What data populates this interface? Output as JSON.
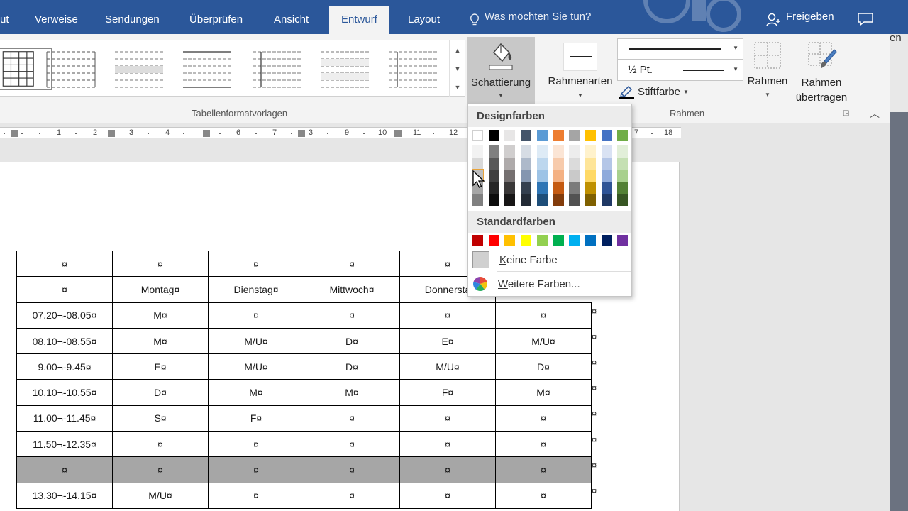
{
  "tabs": [
    "ut",
    "Verweise",
    "Sendungen",
    "Überprüfen",
    "Ansicht",
    "Entwurf",
    "Layout"
  ],
  "active_tab": "Entwurf",
  "tell_me": "Was möchten Sie tun?",
  "share": "Freigeben",
  "strip_letters": "en",
  "ribbon": {
    "table_styles_label": "Tabellenformatvorlagen",
    "shading": "Schattierung",
    "border_styles": "Rahmenarten",
    "pen_weight": "½ Pt.",
    "pen_color": "Stiftfarbe",
    "borders": "Rahmen",
    "border_painter_line1": "Rahmen",
    "border_painter_line2": "übertragen",
    "borders_group_label": "Rahmen"
  },
  "ruler_numbers": [
    "1",
    "2",
    "3",
    "4",
    "6",
    "7",
    "3",
    "9",
    "10",
    "11",
    "12",
    "7",
    "18"
  ],
  "dropdown": {
    "theme_colors_label": "Designfarben",
    "standard_colors_label": "Standardfarben",
    "no_color": "Keine Farbe",
    "more_colors": "Weitere Farben...",
    "theme_top": [
      "#ffffff",
      "#000000",
      "#e7e6e6",
      "#44546a",
      "#5b9bd5",
      "#ed7d31",
      "#a5a5a5",
      "#ffc000",
      "#4472c4",
      "#70ad47"
    ],
    "theme_shades": [
      [
        "#f2f2f2",
        "#d9d9d9",
        "#bfbfbf",
        "#a6a6a6",
        "#808080"
      ],
      [
        "#808080",
        "#595959",
        "#404040",
        "#262626",
        "#0d0d0d"
      ],
      [
        "#d0cece",
        "#aeaaaa",
        "#757070",
        "#3a3838",
        "#171616"
      ],
      [
        "#d6dce4",
        "#adb9ca",
        "#8496b0",
        "#333f4f",
        "#222a35"
      ],
      [
        "#deebf6",
        "#bdd7ee",
        "#9dc3e6",
        "#2e75b5",
        "#1e4e79"
      ],
      [
        "#fbe5d5",
        "#f7cbac",
        "#f4b183",
        "#c55a11",
        "#833c0b"
      ],
      [
        "#ededed",
        "#dbdbdb",
        "#c9c9c9",
        "#7b7b7b",
        "#525252"
      ],
      [
        "#fff2cc",
        "#fee599",
        "#ffd965",
        "#bf9000",
        "#7f6000"
      ],
      [
        "#d9e2f3",
        "#b4c6e7",
        "#8eaadb",
        "#2f5496",
        "#1f3864"
      ],
      [
        "#e2efd9",
        "#c5e0b3",
        "#a8d08d",
        "#538135",
        "#375623"
      ]
    ],
    "standard": [
      "#c00000",
      "#ff0000",
      "#ffc000",
      "#ffff00",
      "#92d050",
      "#00b050",
      "#00b0f0",
      "#0070c0",
      "#002060",
      "#7030a0"
    ]
  },
  "table": {
    "rows": [
      [
        "¤",
        "¤",
        "¤",
        "¤",
        "¤",
        ""
      ],
      [
        "¤",
        "Montag¤",
        "Dienstag¤",
        "Mittwoch¤",
        "Donnersta",
        ""
      ],
      [
        "07.20¬-08.05¤",
        "M¤",
        "¤",
        "¤",
        "¤",
        "¤"
      ],
      [
        "08.10¬-08.55¤",
        "M¤",
        "M/U¤",
        "D¤",
        "E¤",
        "M/U¤"
      ],
      [
        "9.00¬-9.45¤",
        "E¤",
        "M/U¤",
        "D¤",
        "M/U¤",
        "D¤"
      ],
      [
        "10.10¬-10.55¤",
        "D¤",
        "M¤",
        "M¤",
        "F¤",
        "M¤"
      ],
      [
        "11.00¬-11.45¤",
        "S¤",
        "F¤",
        "¤",
        "¤",
        "¤"
      ],
      [
        "11.50¬-12.35¤",
        "¤",
        "¤",
        "¤",
        "¤",
        "¤"
      ],
      [
        "¤",
        "¤",
        "¤",
        "¤",
        "¤",
        "¤"
      ],
      [
        "13.30¬-14.15¤",
        "M/U¤",
        "¤",
        "¤",
        "¤",
        "¤"
      ]
    ],
    "grey_row_index": 8,
    "end_mark": "¤"
  },
  "colors": {
    "accent": "#2b579a",
    "ribbon_bg": "#f3f3f3",
    "hover": "#c8c8c8"
  }
}
